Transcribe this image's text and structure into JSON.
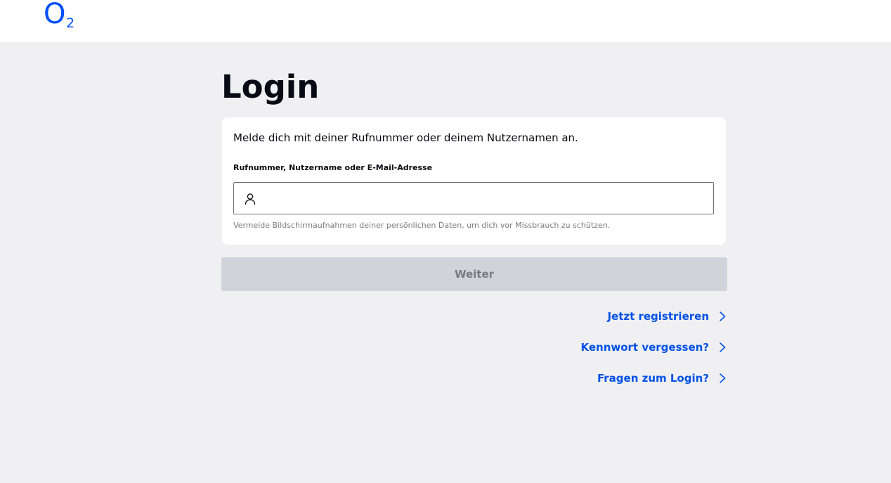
{
  "header": {
    "logo": {
      "letter": "O",
      "subscript": "2"
    }
  },
  "main": {
    "title": "Login",
    "card": {
      "intro": "Melde dich mit deiner Rufnummer oder deinem Nutzernamen an.",
      "field_label": "Rufnummer, Nutzername oder E-Mail-Adresse",
      "input_value": "",
      "input_placeholder": "",
      "hint": "Vermeide Bildschirmaufnahmen deiner persönlichen Daten, um dich vor Missbrauch zu schützen."
    },
    "submit_label": "Weiter",
    "links": {
      "register": "Jetzt registrieren",
      "forgot_password": "Kennwort vergessen?",
      "login_help": "Fragen zum Login?"
    }
  },
  "colors": {
    "brand": "#0050ff",
    "link": "#0050e6",
    "background": "#f0f0f2",
    "button_disabled": "#d2d2da"
  },
  "icons": [
    "o2-logo",
    "user-icon",
    "chevron-right-icon"
  ]
}
